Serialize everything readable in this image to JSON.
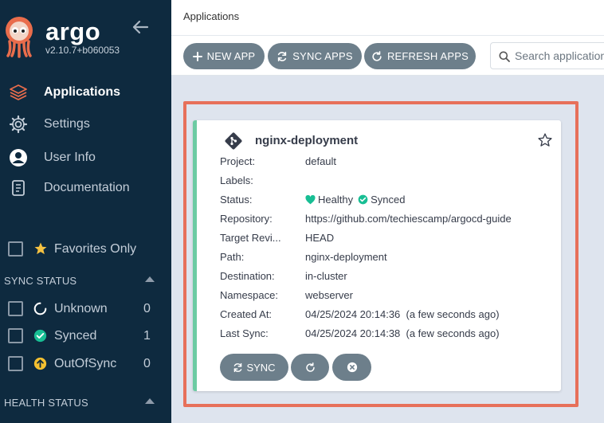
{
  "sidebar": {
    "brand": "argo",
    "version": "v2.10.7+b060053",
    "nav": [
      {
        "label": "Applications",
        "icon": "layers-icon"
      },
      {
        "label": "Settings",
        "icon": "gear-icon"
      },
      {
        "label": "User Info",
        "icon": "user-circle-icon"
      },
      {
        "label": "Documentation",
        "icon": "book-icon"
      }
    ],
    "favorites_label": "Favorites Only",
    "sync_status": {
      "title": "SYNC STATUS",
      "items": [
        {
          "label": "Unknown",
          "count": "0",
          "icon": "circle-notch-icon"
        },
        {
          "label": "Synced",
          "count": "1",
          "icon": "check-circle-icon"
        },
        {
          "label": "OutOfSync",
          "count": "0",
          "icon": "arrow-up-circle-icon"
        }
      ]
    },
    "health_status": {
      "title": "HEALTH STATUS"
    }
  },
  "header": {
    "title": "Applications"
  },
  "toolbar": {
    "new_app": "NEW APP",
    "sync_apps": "SYNC APPS",
    "refresh_apps": "REFRESH APPS",
    "search_placeholder": "Search applications..."
  },
  "app": {
    "name": "nginx-deployment",
    "rows": [
      {
        "key": "Project:",
        "value": "default"
      },
      {
        "key": "Labels:",
        "value": ""
      },
      {
        "key": "Status:",
        "health": "Healthy",
        "sync": "Synced"
      },
      {
        "key": "Repository:",
        "value": "https://github.com/techiescamp/argocd-guide"
      },
      {
        "key": "Target Revi...",
        "value": "HEAD"
      },
      {
        "key": "Path:",
        "value": "nginx-deployment"
      },
      {
        "key": "Destination:",
        "value": "in-cluster"
      },
      {
        "key": "Namespace:",
        "value": "webserver"
      },
      {
        "key": "Created At:",
        "value": "04/25/2024 20:14:36  (a few seconds ago)"
      },
      {
        "key": "Last Sync:",
        "value": "04/25/2024 20:14:38  (a few seconds ago)"
      }
    ],
    "sync_button": "SYNC"
  },
  "colors": {
    "sidebar_bg": "#0e2a3f",
    "button_bg": "#6d7f8b",
    "healthy": "#18be94",
    "highlight": "#e7705a",
    "star": "#f5c242"
  }
}
